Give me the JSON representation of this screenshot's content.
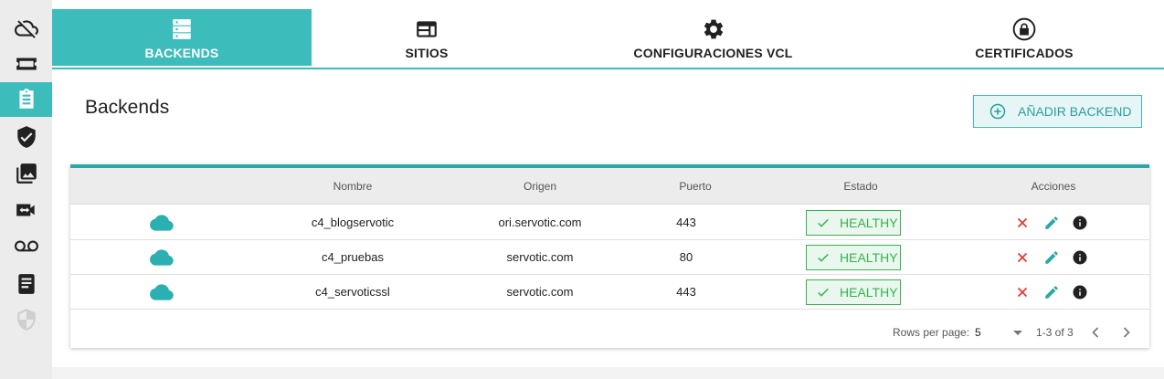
{
  "sidebar": {
    "items": [
      {
        "icon": "cloud-off-icon",
        "active": false
      },
      {
        "icon": "ticket-icon",
        "active": false
      },
      {
        "icon": "clipboard-icon",
        "active": true
      },
      {
        "icon": "shield-check-icon",
        "active": false
      },
      {
        "icon": "photo-library-icon",
        "active": false
      },
      {
        "icon": "video-arrows-icon",
        "active": false
      },
      {
        "icon": "voicemail-icon",
        "active": false
      },
      {
        "icon": "book-icon",
        "active": false
      },
      {
        "icon": "shield-half-icon",
        "active": false
      }
    ]
  },
  "tabs": [
    {
      "label": "BACKENDS",
      "icon": "server-icon",
      "active": true
    },
    {
      "label": "SITIOS",
      "icon": "web-icon",
      "active": false
    },
    {
      "label": "CONFIGURACIONES VCL",
      "icon": "gear-icon",
      "active": false
    },
    {
      "label": "CERTIFICADOS",
      "icon": "lock-icon",
      "active": false
    }
  ],
  "page": {
    "title": "Backends",
    "add_button": "AÑADIR BACKEND"
  },
  "table": {
    "columns": [
      "",
      "Nombre",
      "Origen",
      "Puerto",
      "Estado",
      "Acciones"
    ],
    "rows": [
      {
        "nombre": "c4_blogservotic",
        "origen": "ori.servotic.com",
        "puerto": "443",
        "estado": "HEALTHY"
      },
      {
        "nombre": "c4_pruebas",
        "origen": "servotic.com",
        "puerto": "80",
        "estado": "HEALTHY"
      },
      {
        "nombre": "c4_servoticssl",
        "origen": "servotic.com",
        "puerto": "443",
        "estado": "HEALTHY"
      }
    ],
    "footer": {
      "rows_per_page_label": "Rows per page:",
      "rows_per_page_value": "5",
      "range": "1-3 of 3"
    }
  },
  "colors": {
    "accent": "#3dbcbc",
    "healthy": "#37b24d",
    "delete": "#e53935",
    "edit": "#2aa8a8"
  }
}
